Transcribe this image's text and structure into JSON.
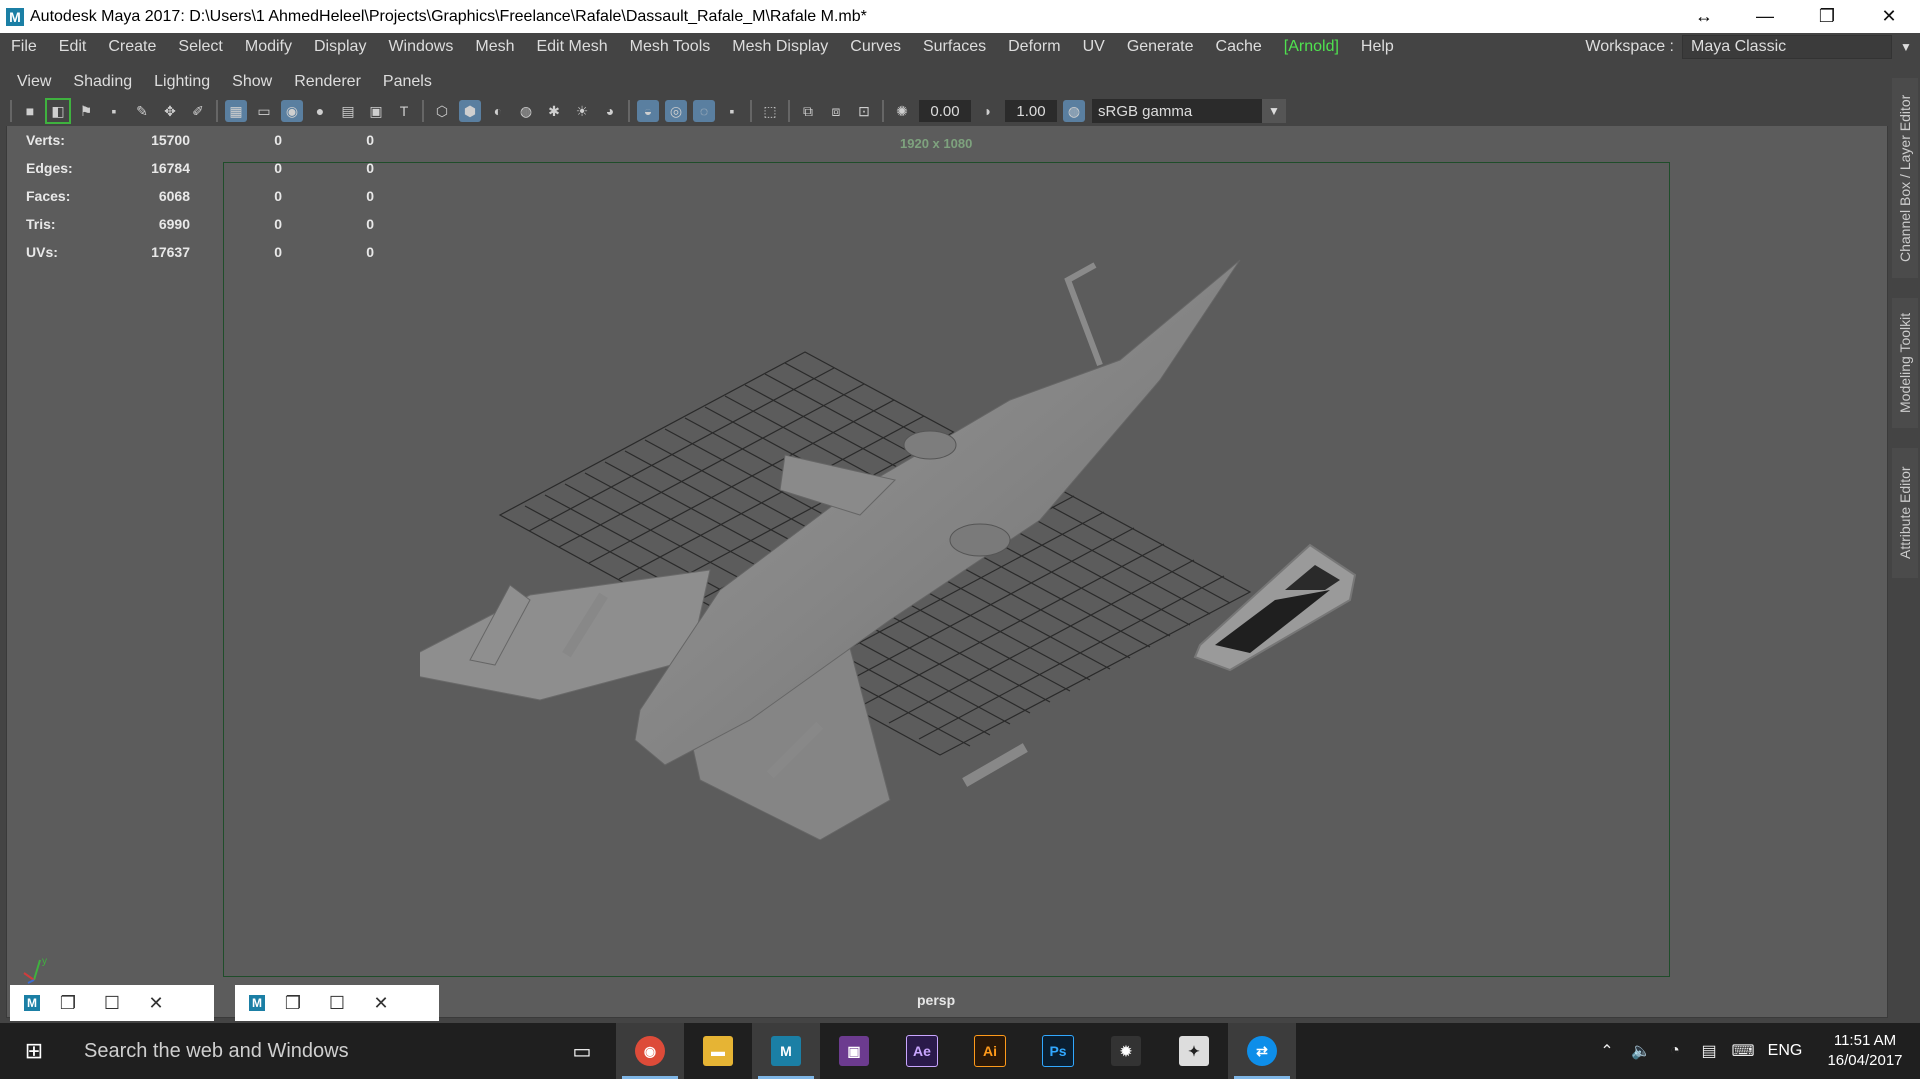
{
  "window": {
    "title": "Autodesk Maya 2017: D:\\Users\\1 AhmedHeleel\\Projects\\Graphics\\Freelance\\Rafale\\Dassault_Rafale_M\\Rafale M.mb*",
    "app_letter": "M"
  },
  "menubar": {
    "items": [
      "File",
      "Edit",
      "Create",
      "Select",
      "Modify",
      "Display",
      "Windows",
      "Mesh",
      "Edit Mesh",
      "Mesh Tools",
      "Mesh Display",
      "Curves",
      "Surfaces",
      "Deform",
      "UV",
      "Generate",
      "Cache",
      "[Arnold]",
      "Help"
    ],
    "workspace_label": "Workspace :",
    "workspace_value": "Maya Classic"
  },
  "panel_menu": [
    "View",
    "Shading",
    "Lighting",
    "Show",
    "Renderer",
    "Panels"
  ],
  "toolbar": {
    "field1": "0.00",
    "field2": "1.00",
    "color_space": "sRGB gamma"
  },
  "hud": {
    "rows": [
      {
        "label": "Verts:",
        "v1": "15700",
        "v2": "0",
        "v3": "0"
      },
      {
        "label": "Edges:",
        "v1": "16784",
        "v2": "0",
        "v3": "0"
      },
      {
        "label": "Faces:",
        "v1": "6068",
        "v2": "0",
        "v3": "0"
      },
      {
        "label": "Tris:",
        "v1": "6990",
        "v2": "0",
        "v3": "0"
      },
      {
        "label": "UVs:",
        "v1": "17637",
        "v2": "0",
        "v3": "0"
      }
    ]
  },
  "viewport": {
    "resolution": "1920 x 1080",
    "camera": "persp",
    "axis_y": "y"
  },
  "right_dock": {
    "tabs": [
      "Channel Box / Layer Editor",
      "Modeling Toolkit",
      "Attribute Editor"
    ]
  },
  "taskbar": {
    "search_placeholder": "Search the web and Windows",
    "lang": "ENG",
    "time": "11:51 AM",
    "date": "16/04/2017"
  },
  "colors": {
    "arnold": "#4fe24f",
    "viewport_bg": "#5c5c5c",
    "maya_blue": "#1b7fa5"
  }
}
